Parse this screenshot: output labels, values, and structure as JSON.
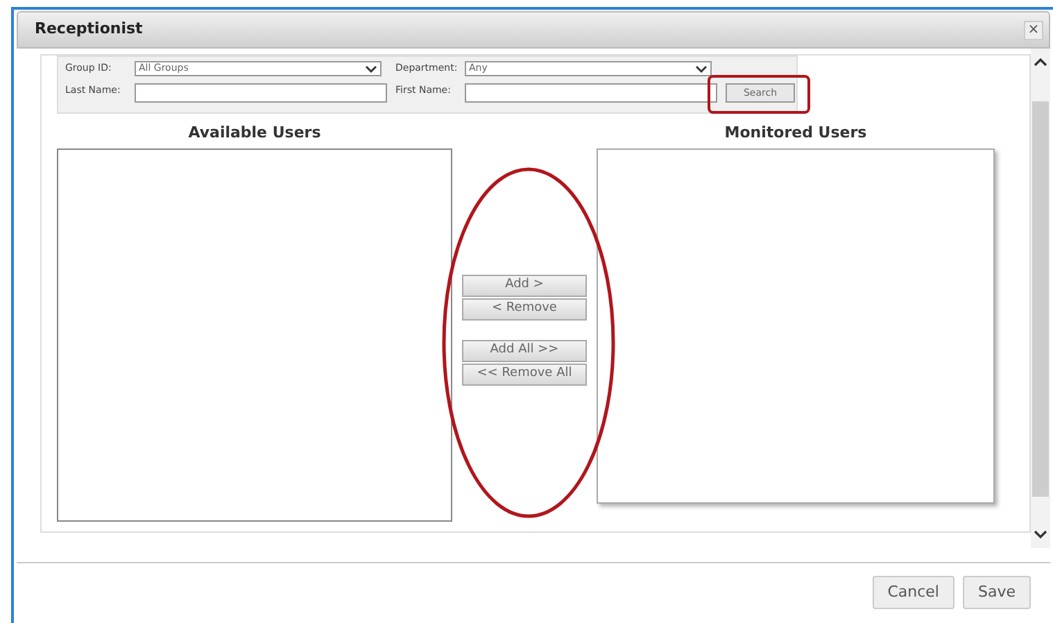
{
  "dialog": {
    "title": "Receptionist",
    "close": "×"
  },
  "filters": [
    {
      "label": "Group ID:",
      "kind": "select",
      "value": "All Groups"
    },
    {
      "label": "Department:",
      "kind": "select",
      "value": "Any"
    },
    {
      "label": "Last Name:",
      "kind": "text"
    },
    {
      "label": "First Name:",
      "kind": "text"
    }
  ],
  "search_button": "Search",
  "available": {
    "heading": "Available Users"
  },
  "monitored": {
    "heading": "Monitored Users"
  },
  "transfer_buttons": [
    [
      "Add >",
      "< Remove"
    ],
    [
      "Add All >>",
      "<< Remove All"
    ]
  ],
  "footer_buttons": [
    "Cancel",
    "Save"
  ]
}
